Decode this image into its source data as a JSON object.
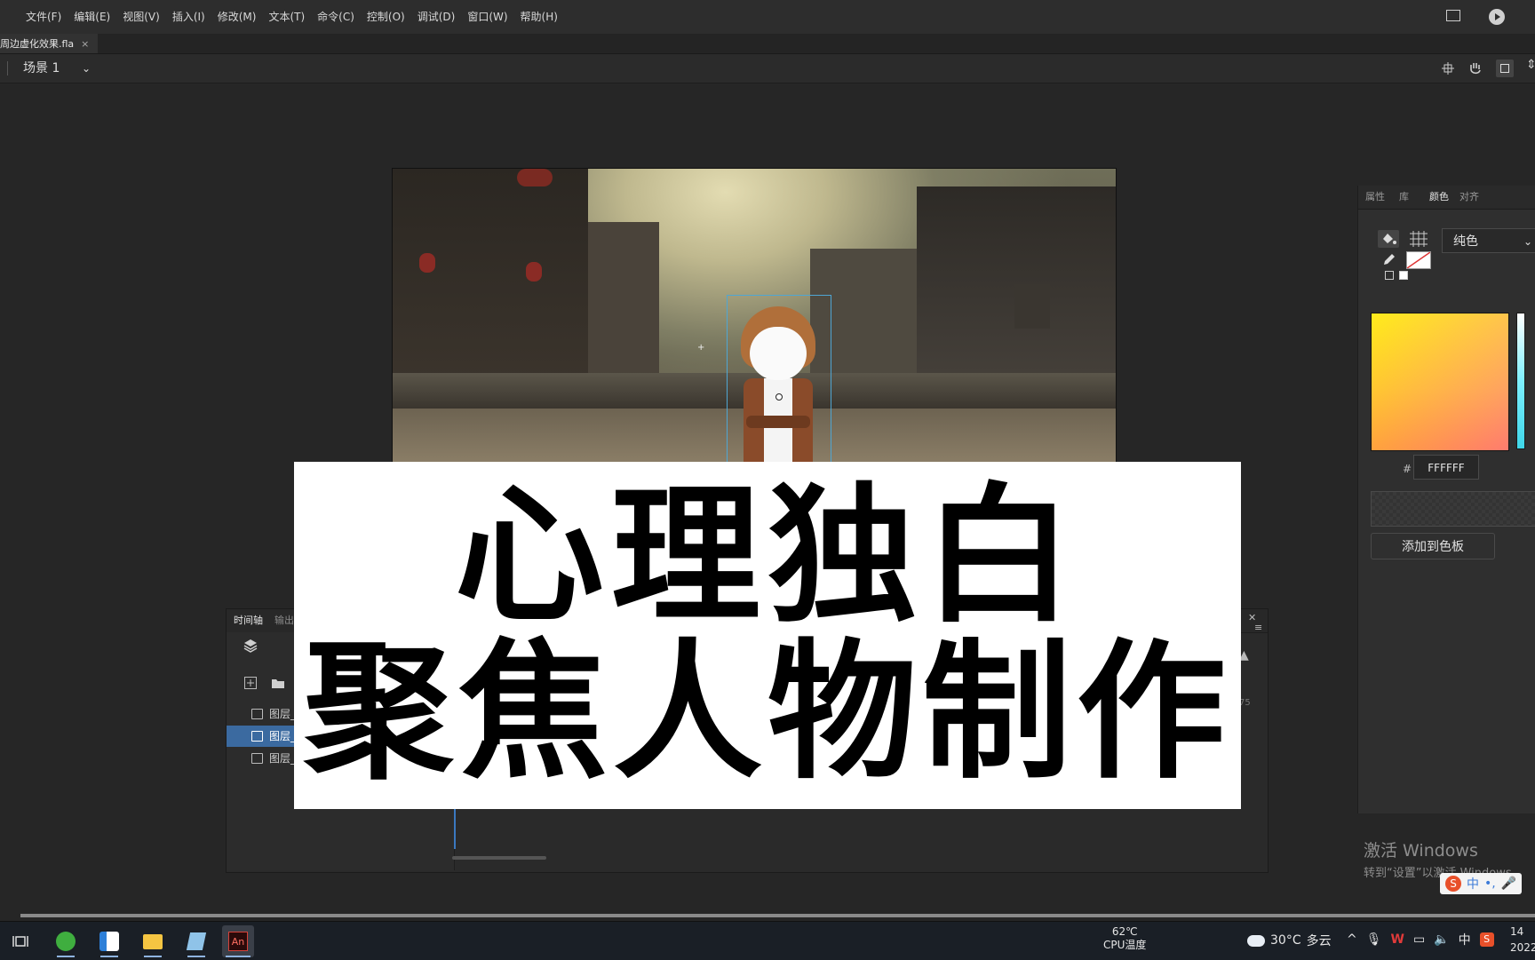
{
  "menubar": {
    "items": [
      "文件(F)",
      "编辑(E)",
      "视图(V)",
      "插入(I)",
      "修改(M)",
      "文本(T)",
      "命令(C)",
      "控制(O)",
      "调试(D)",
      "窗口(W)",
      "帮助(H)"
    ]
  },
  "document": {
    "tab_title": "周边虚化效果.fla",
    "close": "×"
  },
  "scene": {
    "label": "场景 1"
  },
  "timeline": {
    "tabs": [
      "时间轴",
      "输出"
    ],
    "layers": [
      "图层_",
      "图层_",
      "图层_"
    ],
    "frame_label": "75"
  },
  "caption": {
    "line1": "心理独白",
    "line2": "聚焦人物制作"
  },
  "color_panel": {
    "tabs": [
      "属性",
      "库",
      "颜色",
      "对齐"
    ],
    "fill_type": "纯色",
    "hex_prefix": "#",
    "hex": "FFFFFF",
    "add_swatch": "添加到色板"
  },
  "watermark": {
    "title": "激活 Windows",
    "subtitle": "转到“设置”以激活 Windows。"
  },
  "ime": {
    "label": "中"
  },
  "taskbar": {
    "temp": "62℃",
    "temp_label": "CPU温度",
    "weather_temp": "30°C",
    "weather_text": "多云",
    "ime": "中",
    "clock_time": "14",
    "clock_date": "2022"
  },
  "colors": {
    "accent": "#3b6aa0",
    "playhead": "#3a78c0",
    "bg": "#262626"
  }
}
